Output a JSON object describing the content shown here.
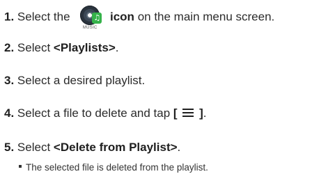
{
  "steps": [
    {
      "number": "1.",
      "before": "Select the",
      "bold": "icon",
      "after": "on the main menu screen."
    },
    {
      "number": "2.",
      "before": "Select",
      "bold": "<Playlists>",
      "after": "."
    },
    {
      "number": "3.",
      "before": "Select a desired playlist.",
      "bold": "",
      "after": ""
    },
    {
      "number": "4.",
      "before": "Select a file to delete and tap",
      "bold_open": "[",
      "bold_close": "]",
      "after": "."
    },
    {
      "number": "5.",
      "before": "Select",
      "bold": "<Delete from Playlist>",
      "after": "."
    }
  ],
  "music_icon": {
    "caption": "MUSIC",
    "icon": "music-disc-icon",
    "accent": "#35b24a"
  },
  "menu_icon": "menu-icon",
  "note": "The selected file is deleted from the playlist."
}
